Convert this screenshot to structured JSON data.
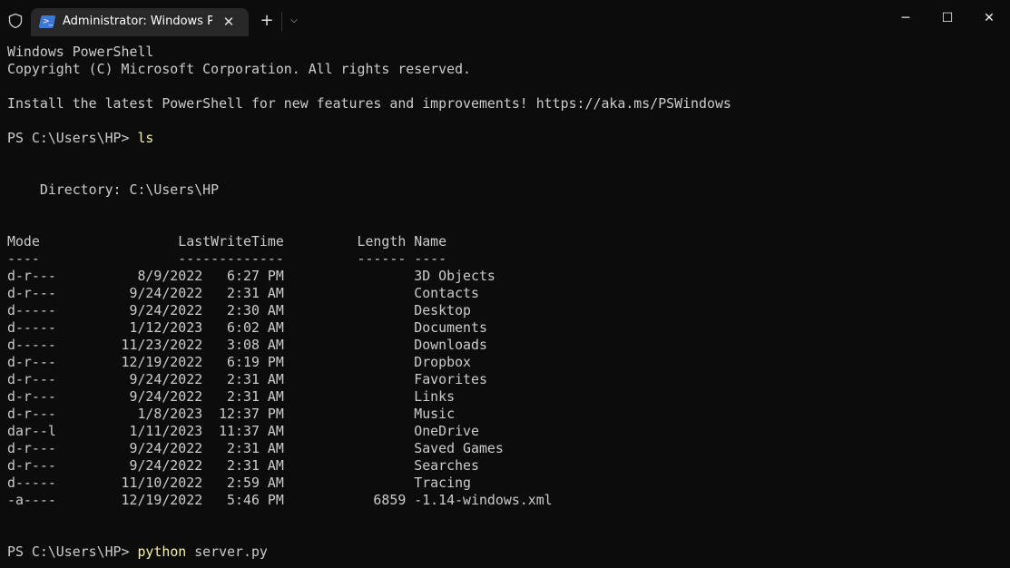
{
  "tab": {
    "title": "Administrator: Windows PowerShell"
  },
  "window_controls": {
    "minimize": "─",
    "maximize": "☐",
    "close": "✕"
  },
  "terminal": {
    "lines": [
      {
        "text": "Windows PowerShell"
      },
      {
        "text": "Copyright (C) Microsoft Corporation. All rights reserved."
      },
      {
        "text": ""
      },
      {
        "text": "Install the latest PowerShell for new features and improvements! https://aka.ms/PSWindows"
      },
      {
        "text": ""
      },
      {
        "prompt": "PS C:\\Users\\HP> ",
        "cmd": "ls",
        "args": ""
      },
      {
        "text": ""
      },
      {
        "text": ""
      },
      {
        "text": "    Directory: C:\\Users\\HP"
      },
      {
        "text": ""
      },
      {
        "text": ""
      },
      {
        "text": "Mode                 LastWriteTime         Length Name"
      },
      {
        "text": "----                 -------------         ------ ----"
      },
      {
        "text": "d-r---          8/9/2022   6:27 PM                3D Objects"
      },
      {
        "text": "d-r---         9/24/2022   2:31 AM                Contacts"
      },
      {
        "text": "d-----         9/24/2022   2:30 AM                Desktop"
      },
      {
        "text": "d-----         1/12/2023   6:02 AM                Documents"
      },
      {
        "text": "d-----        11/23/2022   3:08 AM                Downloads"
      },
      {
        "text": "d-r---        12/19/2022   6:19 PM                Dropbox"
      },
      {
        "text": "d-r---         9/24/2022   2:31 AM                Favorites"
      },
      {
        "text": "d-r---         9/24/2022   2:31 AM                Links"
      },
      {
        "text": "d-r---          1/8/2023  12:37 PM                Music"
      },
      {
        "text": "dar--l         1/11/2023  11:37 AM                OneDrive"
      },
      {
        "text": "d-r---         9/24/2022   2:31 AM                Saved Games"
      },
      {
        "text": "d-r---         9/24/2022   2:31 AM                Searches"
      },
      {
        "text": "d-----        11/10/2022   2:59 AM                Tracing"
      },
      {
        "text": "-a----        12/19/2022   5:46 PM           6859 -1.14-windows.xml"
      },
      {
        "text": ""
      },
      {
        "text": ""
      },
      {
        "prompt": "PS C:\\Users\\HP> ",
        "cmd": "python",
        "args": " server.py"
      }
    ]
  }
}
